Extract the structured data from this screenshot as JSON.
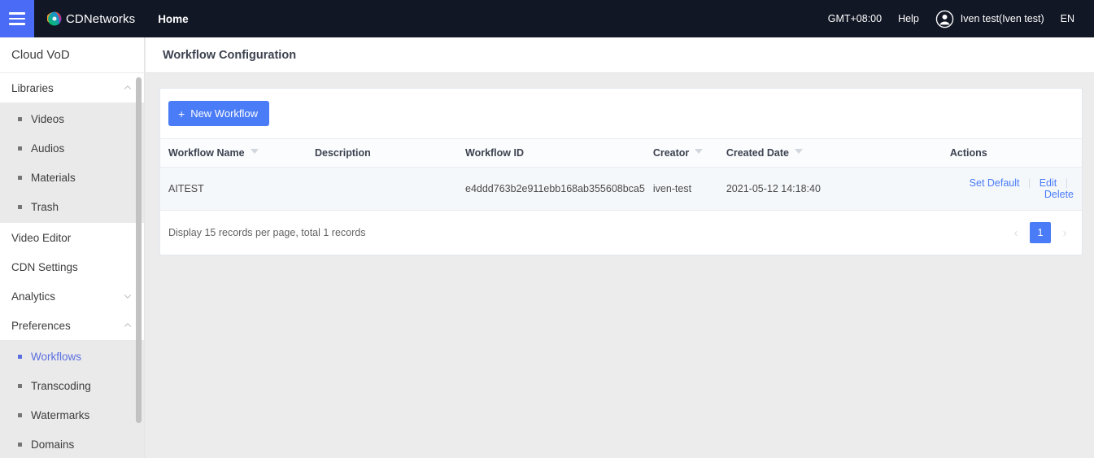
{
  "topbar": {
    "menu_icon": "hamburger-icon",
    "brand": "CDNetworks",
    "nav_home": "Home",
    "timezone": "GMT+08:00",
    "help": "Help",
    "user": "Iven test(Iven test)",
    "language": "EN",
    "avatar_icon": "user-avatar-icon",
    "bg_color": "#121725",
    "accent_color": "#4a6bf5"
  },
  "sidebar": {
    "title": "Cloud VoD",
    "sections": [
      {
        "label": "Libraries",
        "type": "group",
        "expanded": true,
        "chevron": "chevron-up-icon",
        "items": [
          {
            "label": "Videos",
            "active": false
          },
          {
            "label": "Audios",
            "active": false
          },
          {
            "label": "Materials",
            "active": false
          },
          {
            "label": "Trash",
            "active": false
          }
        ]
      },
      {
        "label": "Video Editor",
        "type": "link"
      },
      {
        "label": "CDN Settings",
        "type": "link"
      },
      {
        "label": "Analytics",
        "type": "group",
        "expanded": false,
        "chevron": "chevron-down-icon",
        "items": []
      },
      {
        "label": "Preferences",
        "type": "group",
        "expanded": true,
        "chevron": "chevron-up-icon",
        "items": [
          {
            "label": "Workflows",
            "active": true
          },
          {
            "label": "Transcoding",
            "active": false
          },
          {
            "label": "Watermarks",
            "active": false
          },
          {
            "label": "Domains",
            "active": false
          }
        ]
      }
    ],
    "active_color": "#5c6fe0"
  },
  "page": {
    "title": "Workflow Configuration"
  },
  "toolbar": {
    "new_workflow_label": "New Workflow",
    "new_workflow_icon": "plus-icon",
    "button_color": "#4a7cf7"
  },
  "table": {
    "columns": [
      {
        "label": "Workflow Name",
        "sortable": true
      },
      {
        "label": "Description",
        "sortable": false
      },
      {
        "label": "Workflow ID",
        "sortable": false
      },
      {
        "label": "Creator",
        "sortable": true
      },
      {
        "label": "Created Date",
        "sortable": true
      },
      {
        "label": "Actions",
        "sortable": false
      }
    ],
    "rows": [
      {
        "workflow_name": "AITEST",
        "description": "",
        "workflow_id": "e4ddd763b2e911ebb168ab355608bca5",
        "creator": "iven-test",
        "created_date": "2021-05-12 14:18:40",
        "actions": {
          "set_default": "Set Default",
          "edit": "Edit",
          "delete": "Delete"
        }
      }
    ]
  },
  "footer": {
    "records_text": "Display 15 records per page, total 1 records",
    "pagination": {
      "prev_icon": "chevron-left-icon",
      "next_icon": "chevron-right-icon",
      "current_page": "1"
    }
  }
}
